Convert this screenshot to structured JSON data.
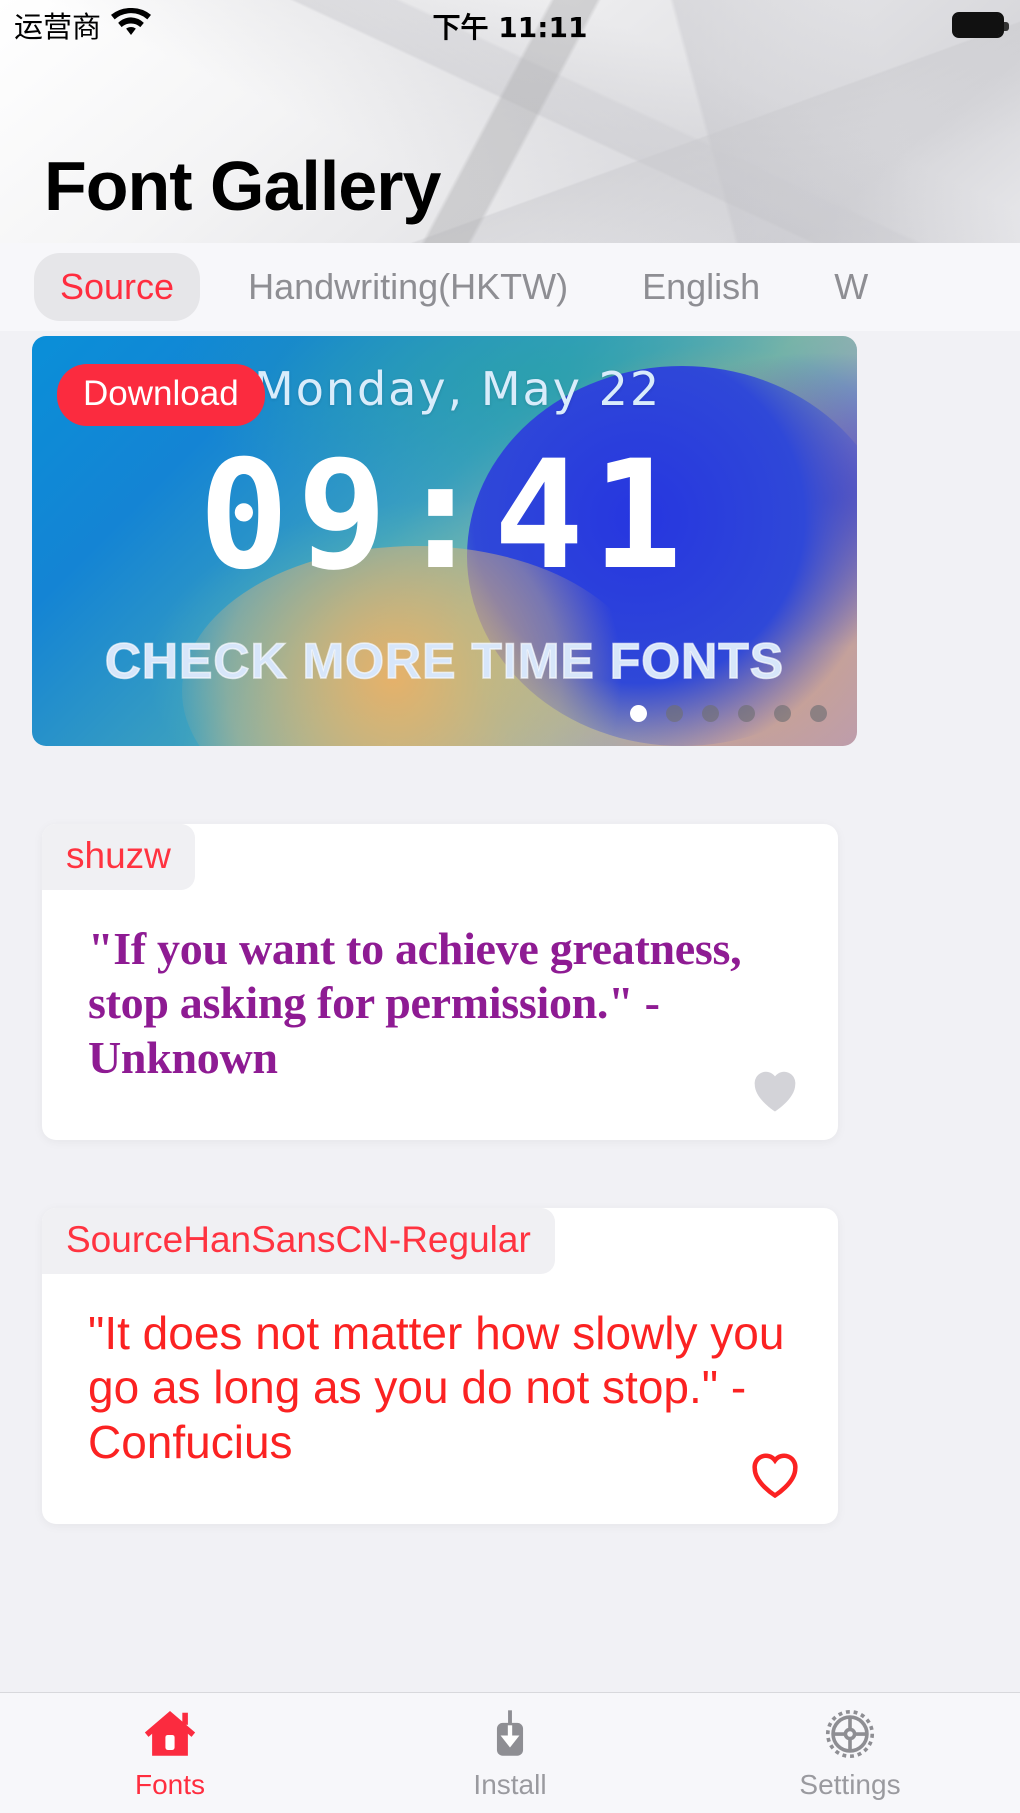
{
  "statusbar": {
    "carrier": "运营商",
    "wifi_icon": "wifi-icon",
    "time": "下午 11:11",
    "battery_icon": "battery-full-icon"
  },
  "header": {
    "title": "Font Gallery"
  },
  "category_tabs": [
    {
      "label": "Source",
      "active": true
    },
    {
      "label": "Handwriting(HKTW)",
      "active": false
    },
    {
      "label": "English",
      "active": false
    },
    {
      "label": "W",
      "active": false
    }
  ],
  "banner": {
    "download_label": "Download",
    "date": "Monday, May 22",
    "clock": "09:41",
    "subtitle": "CHECK MORE TIME FONTS",
    "dots_total": 6,
    "dots_active_index": 0,
    "accent_color": "#fb2b3f"
  },
  "font_cards": [
    {
      "name": "shuzw",
      "quote": "\"If you want to achieve greatness, stop asking for permission.\" - Unknown",
      "text_color": "#8e1b93",
      "favorite_icon": "heart-icon",
      "favorited": false
    },
    {
      "name": "SourceHanSansCN-Regular",
      "quote": "\"It does not matter how slowly you go as long as you do not stop.\" - Confucius",
      "text_color": "#fb2222",
      "favorite_icon": "heart-icon",
      "favorited": true
    }
  ],
  "bottom_tabs": [
    {
      "label": "Fonts",
      "icon": "home-icon",
      "active": true
    },
    {
      "label": "Install",
      "icon": "download-icon",
      "active": false
    },
    {
      "label": "Settings",
      "icon": "gear-icon",
      "active": false
    }
  ]
}
